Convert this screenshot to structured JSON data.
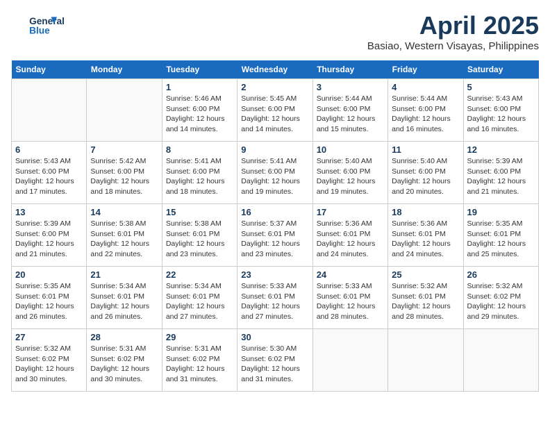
{
  "header": {
    "logo_line1": "General",
    "logo_line2": "Blue",
    "month": "April 2025",
    "location": "Basiao, Western Visayas, Philippines"
  },
  "days_of_week": [
    "Sunday",
    "Monday",
    "Tuesday",
    "Wednesday",
    "Thursday",
    "Friday",
    "Saturday"
  ],
  "weeks": [
    [
      {
        "day": "",
        "detail": ""
      },
      {
        "day": "",
        "detail": ""
      },
      {
        "day": "1",
        "detail": "Sunrise: 5:46 AM\nSunset: 6:00 PM\nDaylight: 12 hours and 14 minutes."
      },
      {
        "day": "2",
        "detail": "Sunrise: 5:45 AM\nSunset: 6:00 PM\nDaylight: 12 hours and 14 minutes."
      },
      {
        "day": "3",
        "detail": "Sunrise: 5:44 AM\nSunset: 6:00 PM\nDaylight: 12 hours and 15 minutes."
      },
      {
        "day": "4",
        "detail": "Sunrise: 5:44 AM\nSunset: 6:00 PM\nDaylight: 12 hours and 16 minutes."
      },
      {
        "day": "5",
        "detail": "Sunrise: 5:43 AM\nSunset: 6:00 PM\nDaylight: 12 hours and 16 minutes."
      }
    ],
    [
      {
        "day": "6",
        "detail": "Sunrise: 5:43 AM\nSunset: 6:00 PM\nDaylight: 12 hours and 17 minutes."
      },
      {
        "day": "7",
        "detail": "Sunrise: 5:42 AM\nSunset: 6:00 PM\nDaylight: 12 hours and 18 minutes."
      },
      {
        "day": "8",
        "detail": "Sunrise: 5:41 AM\nSunset: 6:00 PM\nDaylight: 12 hours and 18 minutes."
      },
      {
        "day": "9",
        "detail": "Sunrise: 5:41 AM\nSunset: 6:00 PM\nDaylight: 12 hours and 19 minutes."
      },
      {
        "day": "10",
        "detail": "Sunrise: 5:40 AM\nSunset: 6:00 PM\nDaylight: 12 hours and 19 minutes."
      },
      {
        "day": "11",
        "detail": "Sunrise: 5:40 AM\nSunset: 6:00 PM\nDaylight: 12 hours and 20 minutes."
      },
      {
        "day": "12",
        "detail": "Sunrise: 5:39 AM\nSunset: 6:00 PM\nDaylight: 12 hours and 21 minutes."
      }
    ],
    [
      {
        "day": "13",
        "detail": "Sunrise: 5:39 AM\nSunset: 6:00 PM\nDaylight: 12 hours and 21 minutes."
      },
      {
        "day": "14",
        "detail": "Sunrise: 5:38 AM\nSunset: 6:01 PM\nDaylight: 12 hours and 22 minutes."
      },
      {
        "day": "15",
        "detail": "Sunrise: 5:38 AM\nSunset: 6:01 PM\nDaylight: 12 hours and 23 minutes."
      },
      {
        "day": "16",
        "detail": "Sunrise: 5:37 AM\nSunset: 6:01 PM\nDaylight: 12 hours and 23 minutes."
      },
      {
        "day": "17",
        "detail": "Sunrise: 5:36 AM\nSunset: 6:01 PM\nDaylight: 12 hours and 24 minutes."
      },
      {
        "day": "18",
        "detail": "Sunrise: 5:36 AM\nSunset: 6:01 PM\nDaylight: 12 hours and 24 minutes."
      },
      {
        "day": "19",
        "detail": "Sunrise: 5:35 AM\nSunset: 6:01 PM\nDaylight: 12 hours and 25 minutes."
      }
    ],
    [
      {
        "day": "20",
        "detail": "Sunrise: 5:35 AM\nSunset: 6:01 PM\nDaylight: 12 hours and 26 minutes."
      },
      {
        "day": "21",
        "detail": "Sunrise: 5:34 AM\nSunset: 6:01 PM\nDaylight: 12 hours and 26 minutes."
      },
      {
        "day": "22",
        "detail": "Sunrise: 5:34 AM\nSunset: 6:01 PM\nDaylight: 12 hours and 27 minutes."
      },
      {
        "day": "23",
        "detail": "Sunrise: 5:33 AM\nSunset: 6:01 PM\nDaylight: 12 hours and 27 minutes."
      },
      {
        "day": "24",
        "detail": "Sunrise: 5:33 AM\nSunset: 6:01 PM\nDaylight: 12 hours and 28 minutes."
      },
      {
        "day": "25",
        "detail": "Sunrise: 5:32 AM\nSunset: 6:01 PM\nDaylight: 12 hours and 28 minutes."
      },
      {
        "day": "26",
        "detail": "Sunrise: 5:32 AM\nSunset: 6:02 PM\nDaylight: 12 hours and 29 minutes."
      }
    ],
    [
      {
        "day": "27",
        "detail": "Sunrise: 5:32 AM\nSunset: 6:02 PM\nDaylight: 12 hours and 30 minutes."
      },
      {
        "day": "28",
        "detail": "Sunrise: 5:31 AM\nSunset: 6:02 PM\nDaylight: 12 hours and 30 minutes."
      },
      {
        "day": "29",
        "detail": "Sunrise: 5:31 AM\nSunset: 6:02 PM\nDaylight: 12 hours and 31 minutes."
      },
      {
        "day": "30",
        "detail": "Sunrise: 5:30 AM\nSunset: 6:02 PM\nDaylight: 12 hours and 31 minutes."
      },
      {
        "day": "",
        "detail": ""
      },
      {
        "day": "",
        "detail": ""
      },
      {
        "day": "",
        "detail": ""
      }
    ]
  ]
}
